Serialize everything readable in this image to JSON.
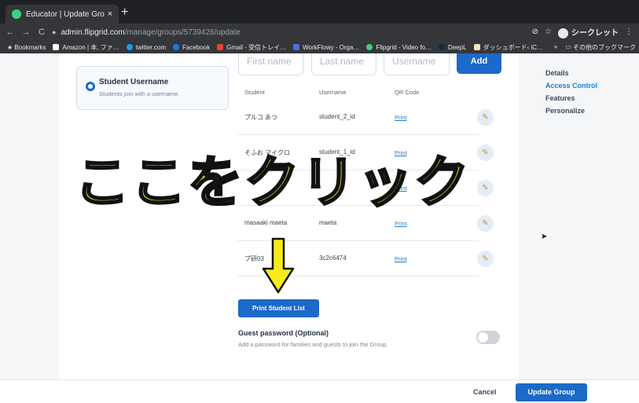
{
  "browser": {
    "tab_title": "Educator | Update Group",
    "tab_close": "×",
    "new_tab": "+",
    "url_host": "admin.flipgrid.com",
    "url_path": "/manage/groups/5739426/update",
    "incognito_label": "シークレット",
    "bookmarks": [
      "Bookmarks",
      "Amazon | 本, ファ…",
      "twitter.com",
      "Facebook",
      "Gmail - 受信トレイ…",
      "WorkFlowy - Orga…",
      "Flipgrid - Video fo…",
      "DeepL",
      "ダッシュボード‹ iC…"
    ],
    "bookmarks_overflow": "»",
    "other_bookmarks": "その他のブックマーク"
  },
  "option": {
    "title": "Student Username",
    "subtitle": "Students join with a username."
  },
  "inputs": {
    "first_name_placeholder": "First name",
    "last_name_placeholder": "Last name",
    "username_placeholder": "Username",
    "add_label": "Add"
  },
  "table": {
    "headers": [
      "Student",
      "Username",
      "QR Code"
    ],
    "rows": [
      {
        "student": "プルコ あつ",
        "username": "student_2_id",
        "qr": "Print"
      },
      {
        "student": "そふお マイクロ",
        "username": "student_1_id",
        "qr": "Print"
      },
      {
        "student": "",
        "username": "",
        "qr": "Print"
      },
      {
        "student": "masaaki maeta",
        "username": "maeta",
        "qr": "Print"
      },
      {
        "student": "プ研03",
        "username": "3c2c6474",
        "qr": "Print"
      }
    ]
  },
  "print_list_label": "Print Student List",
  "guest": {
    "title": "Guest password (Optional)",
    "subtitle": "Add a password for families and guests to join the Group.",
    "enabled": false
  },
  "sidebar": [
    "Details",
    "Access Control",
    "Features",
    "Personalize"
  ],
  "sidebar_active": "Access Control",
  "footer": {
    "cancel": "Cancel",
    "update": "Update Group"
  },
  "overlay": {
    "caption": "ここをクリック",
    "caption_color": "#f7ea1c"
  },
  "colors": {
    "accent": "#1b6ac9",
    "link": "#1b7ccc"
  }
}
